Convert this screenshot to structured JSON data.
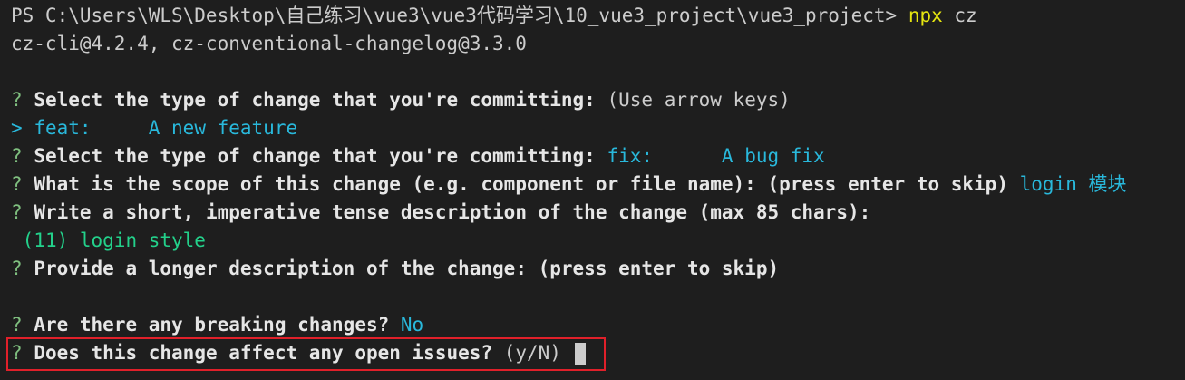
{
  "prompt": {
    "prefix": "PS C:\\Users\\WLS\\Desktop\\自己练习\\vue3\\vue3代码学习\\10_vue3_project\\vue3_project>",
    "command": "npx",
    "args": "cz"
  },
  "version_line": "cz-cli@4.2.4, cz-conventional-changelog@3.3.0",
  "qmark": "?",
  "pointer": ">",
  "lines": {
    "type_question": "Select the type of change that you're committing:",
    "type_hint": "(Use arrow keys)",
    "selected_option": "feat:     A new feature",
    "type_answer": "fix:      A bug fix",
    "scope_question": "What is the scope of this change (e.g. component or file name): (press enter to skip)",
    "scope_answer": "login 模块",
    "short_question": "Write a short, imperative tense description of the change (max 85 chars):",
    "short_answer": "(11) login style",
    "long_question": "Provide a longer description of the change: (press enter to skip)",
    "breaking_question": "Are there any breaking changes?",
    "breaking_answer": "No",
    "issues_question": "Does this change affect any open issues?",
    "issues_hint": "(y/N)"
  },
  "colors": {
    "background": "#1e1e1e",
    "highlight_border": "#e0202a",
    "answer_cyan": "#29b8db",
    "answer_green": "#23d18b",
    "command_yellow": "#e5e510"
  }
}
